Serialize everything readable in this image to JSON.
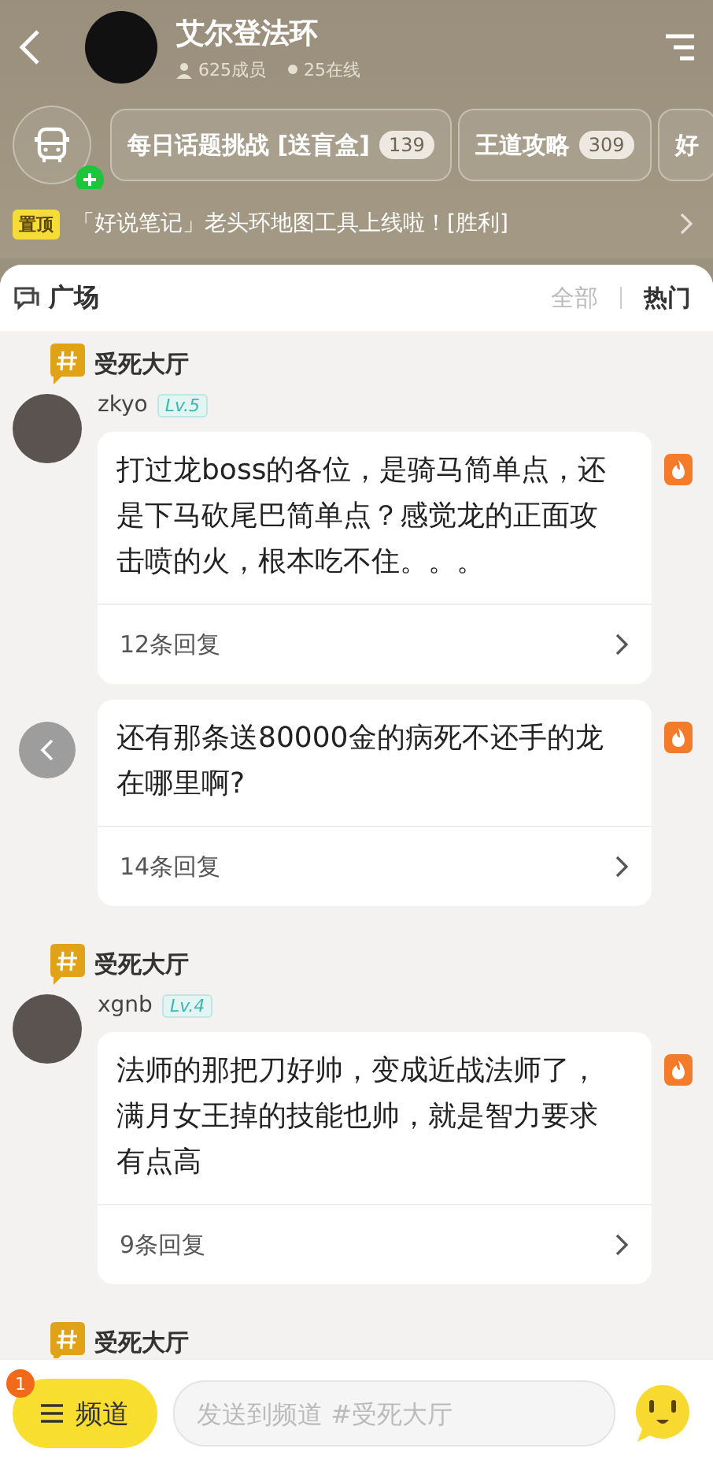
{
  "header": {
    "title": "艾尔登法环",
    "members": "625成员",
    "online": "25在线"
  },
  "channels": [
    {
      "label": "每日话题挑战 [送盲盒]",
      "count": "139"
    },
    {
      "label": "王道攻略",
      "count": "309"
    },
    {
      "label": "好"
    }
  ],
  "pinned": {
    "badge": "置顶",
    "text": "「好说笔记」老头环地图工具上线啦！[胜利]"
  },
  "square": {
    "title": "广场",
    "tabs": [
      {
        "label": "全部",
        "selected": false
      },
      {
        "label": "热门",
        "selected": true
      }
    ]
  },
  "feed": [
    {
      "channel": "受死大厅",
      "user": "zkyo",
      "level_badge": "Lv.5",
      "messages": [
        {
          "text": "打过龙boss的各位，是骑马简单点，还是下马砍尾巴简单点？感觉龙的正面攻击喷的火，根本吃不住。。。",
          "replies": "12条回复",
          "hot": true
        },
        {
          "text": "还有那条送80000金的病死不还手的龙在哪里啊?",
          "replies": "14条回复",
          "hot": true
        }
      ]
    },
    {
      "channel": "受死大厅",
      "user": "xgnb",
      "level_badge": "Lv.4",
      "messages": [
        {
          "text": "法师的那把刀好帅，变成近战法师了，满月女王掉的技能也帅，就是智力要求有点高",
          "replies": "9条回复",
          "hot": true
        }
      ]
    },
    {
      "channel": "受死大厅"
    }
  ],
  "bottom": {
    "channel_button": "频道",
    "badge": "1",
    "placeholder": "发送到频道 #受死大厅"
  }
}
